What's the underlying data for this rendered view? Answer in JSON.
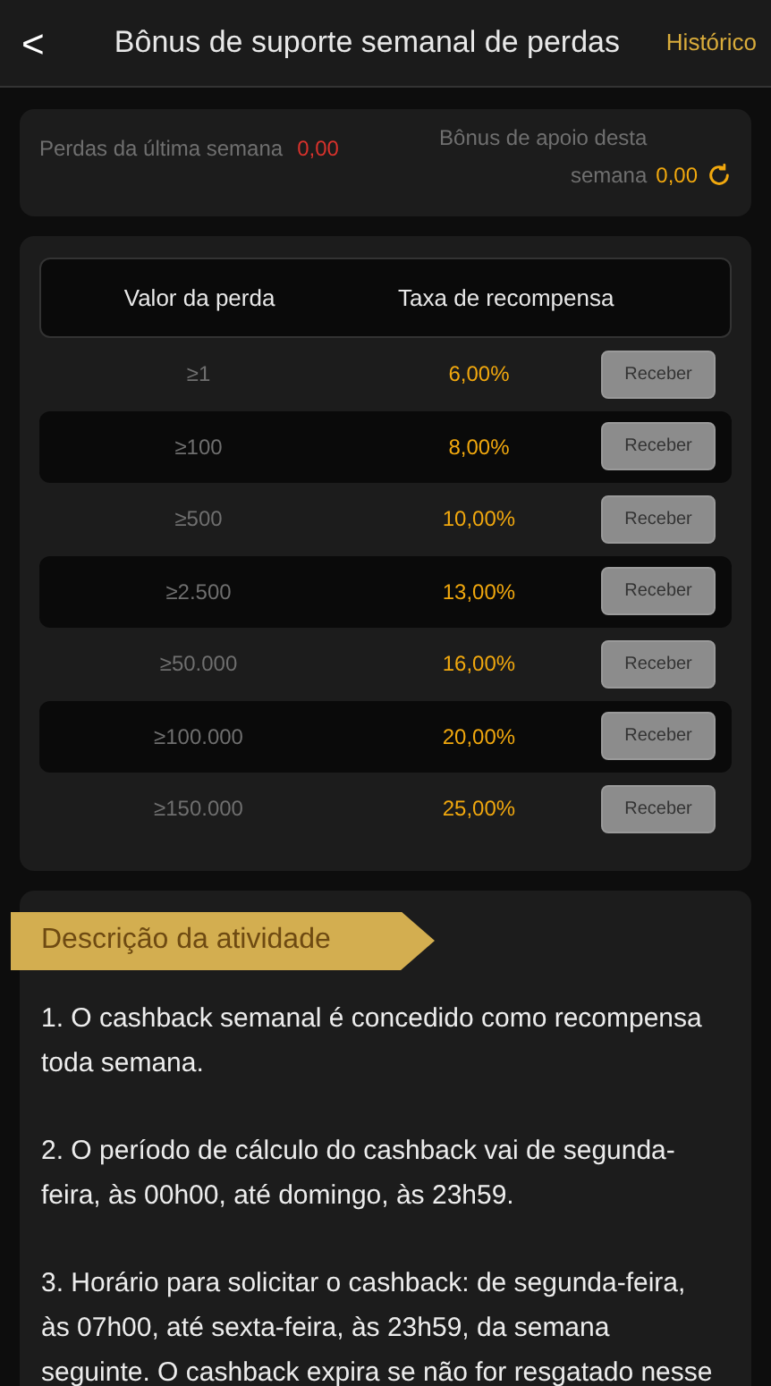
{
  "header": {
    "back": "<",
    "title": "Bônus de suporte semanal de perdas",
    "history_link": "Histórico"
  },
  "summary": {
    "last_week_label": "Perdas da última semana",
    "last_week_value": "0,00",
    "bonus_label": "Bônus de apoio desta semana",
    "bonus_value": "0,00"
  },
  "table": {
    "columns": [
      "Valor da perda",
      "Taxa de recompensa"
    ],
    "rows": [
      {
        "loss": "≥1",
        "rate": "6,00%",
        "action": "Receber"
      },
      {
        "loss": "≥100",
        "rate": "8,00%",
        "action": "Receber"
      },
      {
        "loss": "≥500",
        "rate": "10,00%",
        "action": "Receber"
      },
      {
        "loss": "≥2.500",
        "rate": "13,00%",
        "action": "Receber"
      },
      {
        "loss": "≥50.000",
        "rate": "16,00%",
        "action": "Receber"
      },
      {
        "loss": "≥100.000",
        "rate": "20,00%",
        "action": "Receber"
      },
      {
        "loss": "≥150.000",
        "rate": "25,00%",
        "action": "Receber"
      }
    ]
  },
  "description": {
    "title": "Descrição da atividade",
    "paragraphs": [
      "1. O cashback semanal é concedido como recompensa toda semana.",
      "2. O período de cálculo do cashback vai de segunda-feira, às 00h00, até domingo, às 23h59.",
      "3. Horário para solicitar o cashback: de segunda-feira, às 07h00, até sexta-feira, às 23h59, da semana seguinte. O cashback expira se não for resgatado nesse"
    ]
  }
}
